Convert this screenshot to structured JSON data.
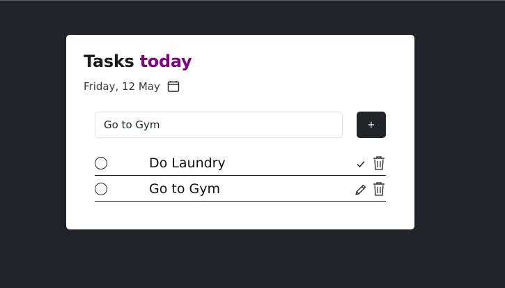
{
  "header": {
    "title_main": "Tasks",
    "title_accent": "today",
    "accent_color": "#800080",
    "date": "Friday, 12 May"
  },
  "new_task": {
    "value": "Go to Gym",
    "add_label": "+"
  },
  "tasks": [
    {
      "text": "Do Laundry",
      "action_icon": "check-icon"
    },
    {
      "text": "Go to Gym",
      "action_icon": "pencil-icon"
    }
  ],
  "colors": {
    "background": "#212529",
    "card": "#ffffff",
    "button": "#212529"
  }
}
